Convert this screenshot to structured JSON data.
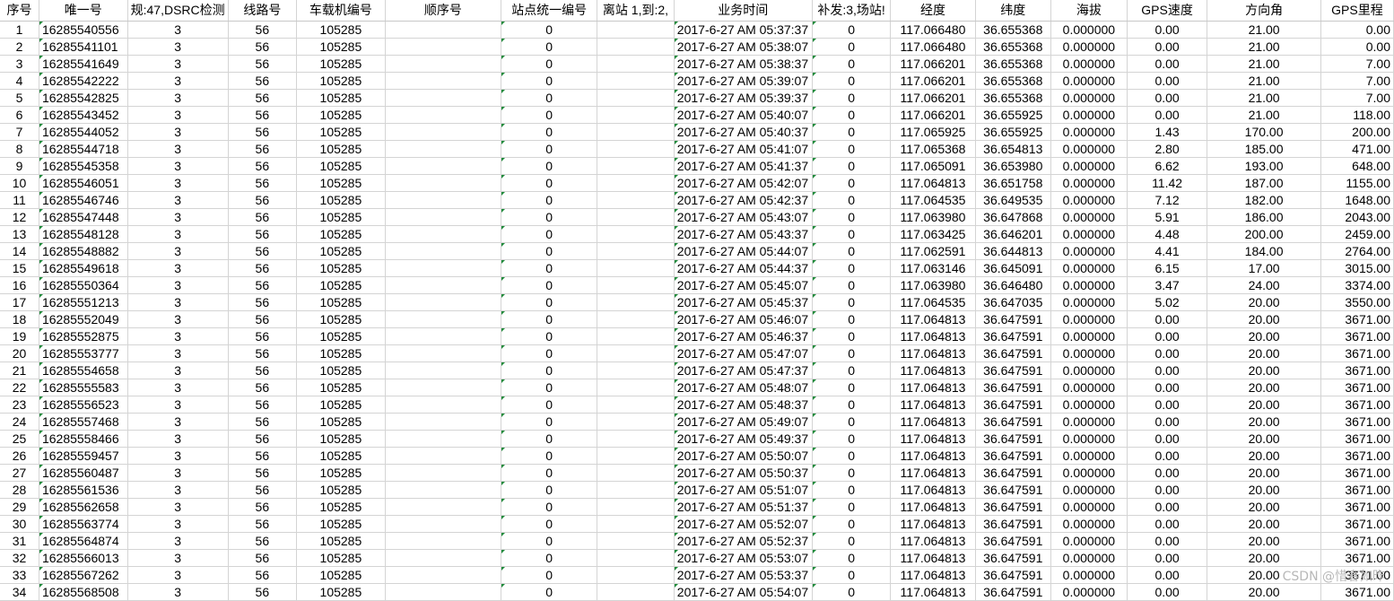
{
  "headers": [
    "序号",
    "唯一号",
    "规:47,DSRC检测",
    "线路号",
    "车载机编号",
    "顺序号",
    "站点统一编号",
    "离站 1,到:2,",
    "业务时间",
    "补发:3,场站!",
    "经度",
    "纬度",
    "海拔",
    "GPS速度",
    "方向角",
    "GPS里程"
  ],
  "rows": [
    [
      "1",
      "16285540556",
      "3",
      "56",
      "105285",
      "",
      "0",
      "",
      "2017-6-27 AM 05:37:37",
      "0",
      "117.066480",
      "36.655368",
      "0.000000",
      "0.00",
      "21.00",
      "0.00"
    ],
    [
      "2",
      "16285541101",
      "3",
      "56",
      "105285",
      "",
      "0",
      "",
      "2017-6-27 AM 05:38:07",
      "0",
      "117.066480",
      "36.655368",
      "0.000000",
      "0.00",
      "21.00",
      "0.00"
    ],
    [
      "3",
      "16285541649",
      "3",
      "56",
      "105285",
      "",
      "0",
      "",
      "2017-6-27 AM 05:38:37",
      "0",
      "117.066201",
      "36.655368",
      "0.000000",
      "0.00",
      "21.00",
      "7.00"
    ],
    [
      "4",
      "16285542222",
      "3",
      "56",
      "105285",
      "",
      "0",
      "",
      "2017-6-27 AM 05:39:07",
      "0",
      "117.066201",
      "36.655368",
      "0.000000",
      "0.00",
      "21.00",
      "7.00"
    ],
    [
      "5",
      "16285542825",
      "3",
      "56",
      "105285",
      "",
      "0",
      "",
      "2017-6-27 AM 05:39:37",
      "0",
      "117.066201",
      "36.655368",
      "0.000000",
      "0.00",
      "21.00",
      "7.00"
    ],
    [
      "6",
      "16285543452",
      "3",
      "56",
      "105285",
      "",
      "0",
      "",
      "2017-6-27 AM 05:40:07",
      "0",
      "117.066201",
      "36.655925",
      "0.000000",
      "0.00",
      "21.00",
      "118.00"
    ],
    [
      "7",
      "16285544052",
      "3",
      "56",
      "105285",
      "",
      "0",
      "",
      "2017-6-27 AM 05:40:37",
      "0",
      "117.065925",
      "36.655925",
      "0.000000",
      "1.43",
      "170.00",
      "200.00"
    ],
    [
      "8",
      "16285544718",
      "3",
      "56",
      "105285",
      "",
      "0",
      "",
      "2017-6-27 AM 05:41:07",
      "0",
      "117.065368",
      "36.654813",
      "0.000000",
      "2.80",
      "185.00",
      "471.00"
    ],
    [
      "9",
      "16285545358",
      "3",
      "56",
      "105285",
      "",
      "0",
      "",
      "2017-6-27 AM 05:41:37",
      "0",
      "117.065091",
      "36.653980",
      "0.000000",
      "6.62",
      "193.00",
      "648.00"
    ],
    [
      "10",
      "16285546051",
      "3",
      "56",
      "105285",
      "",
      "0",
      "",
      "2017-6-27 AM 05:42:07",
      "0",
      "117.064813",
      "36.651758",
      "0.000000",
      "11.42",
      "187.00",
      "1155.00"
    ],
    [
      "11",
      "16285546746",
      "3",
      "56",
      "105285",
      "",
      "0",
      "",
      "2017-6-27 AM 05:42:37",
      "0",
      "117.064535",
      "36.649535",
      "0.000000",
      "7.12",
      "182.00",
      "1648.00"
    ],
    [
      "12",
      "16285547448",
      "3",
      "56",
      "105285",
      "",
      "0",
      "",
      "2017-6-27 AM 05:43:07",
      "0",
      "117.063980",
      "36.647868",
      "0.000000",
      "5.91",
      "186.00",
      "2043.00"
    ],
    [
      "13",
      "16285548128",
      "3",
      "56",
      "105285",
      "",
      "0",
      "",
      "2017-6-27 AM 05:43:37",
      "0",
      "117.063425",
      "36.646201",
      "0.000000",
      "4.48",
      "200.00",
      "2459.00"
    ],
    [
      "14",
      "16285548882",
      "3",
      "56",
      "105285",
      "",
      "0",
      "",
      "2017-6-27 AM 05:44:07",
      "0",
      "117.062591",
      "36.644813",
      "0.000000",
      "4.41",
      "184.00",
      "2764.00"
    ],
    [
      "15",
      "16285549618",
      "3",
      "56",
      "105285",
      "",
      "0",
      "",
      "2017-6-27 AM 05:44:37",
      "0",
      "117.063146",
      "36.645091",
      "0.000000",
      "6.15",
      "17.00",
      "3015.00"
    ],
    [
      "16",
      "16285550364",
      "3",
      "56",
      "105285",
      "",
      "0",
      "",
      "2017-6-27 AM 05:45:07",
      "0",
      "117.063980",
      "36.646480",
      "0.000000",
      "3.47",
      "24.00",
      "3374.00"
    ],
    [
      "17",
      "16285551213",
      "3",
      "56",
      "105285",
      "",
      "0",
      "",
      "2017-6-27 AM 05:45:37",
      "0",
      "117.064535",
      "36.647035",
      "0.000000",
      "5.02",
      "20.00",
      "3550.00"
    ],
    [
      "18",
      "16285552049",
      "3",
      "56",
      "105285",
      "",
      "0",
      "",
      "2017-6-27 AM 05:46:07",
      "0",
      "117.064813",
      "36.647591",
      "0.000000",
      "0.00",
      "20.00",
      "3671.00"
    ],
    [
      "19",
      "16285552875",
      "3",
      "56",
      "105285",
      "",
      "0",
      "",
      "2017-6-27 AM 05:46:37",
      "0",
      "117.064813",
      "36.647591",
      "0.000000",
      "0.00",
      "20.00",
      "3671.00"
    ],
    [
      "20",
      "16285553777",
      "3",
      "56",
      "105285",
      "",
      "0",
      "",
      "2017-6-27 AM 05:47:07",
      "0",
      "117.064813",
      "36.647591",
      "0.000000",
      "0.00",
      "20.00",
      "3671.00"
    ],
    [
      "21",
      "16285554658",
      "3",
      "56",
      "105285",
      "",
      "0",
      "",
      "2017-6-27 AM 05:47:37",
      "0",
      "117.064813",
      "36.647591",
      "0.000000",
      "0.00",
      "20.00",
      "3671.00"
    ],
    [
      "22",
      "16285555583",
      "3",
      "56",
      "105285",
      "",
      "0",
      "",
      "2017-6-27 AM 05:48:07",
      "0",
      "117.064813",
      "36.647591",
      "0.000000",
      "0.00",
      "20.00",
      "3671.00"
    ],
    [
      "23",
      "16285556523",
      "3",
      "56",
      "105285",
      "",
      "0",
      "",
      "2017-6-27 AM 05:48:37",
      "0",
      "117.064813",
      "36.647591",
      "0.000000",
      "0.00",
      "20.00",
      "3671.00"
    ],
    [
      "24",
      "16285557468",
      "3",
      "56",
      "105285",
      "",
      "0",
      "",
      "2017-6-27 AM 05:49:07",
      "0",
      "117.064813",
      "36.647591",
      "0.000000",
      "0.00",
      "20.00",
      "3671.00"
    ],
    [
      "25",
      "16285558466",
      "3",
      "56",
      "105285",
      "",
      "0",
      "",
      "2017-6-27 AM 05:49:37",
      "0",
      "117.064813",
      "36.647591",
      "0.000000",
      "0.00",
      "20.00",
      "3671.00"
    ],
    [
      "26",
      "16285559457",
      "3",
      "56",
      "105285",
      "",
      "0",
      "",
      "2017-6-27 AM 05:50:07",
      "0",
      "117.064813",
      "36.647591",
      "0.000000",
      "0.00",
      "20.00",
      "3671.00"
    ],
    [
      "27",
      "16285560487",
      "3",
      "56",
      "105285",
      "",
      "0",
      "",
      "2017-6-27 AM 05:50:37",
      "0",
      "117.064813",
      "36.647591",
      "0.000000",
      "0.00",
      "20.00",
      "3671.00"
    ],
    [
      "28",
      "16285561536",
      "3",
      "56",
      "105285",
      "",
      "0",
      "",
      "2017-6-27 AM 05:51:07",
      "0",
      "117.064813",
      "36.647591",
      "0.000000",
      "0.00",
      "20.00",
      "3671.00"
    ],
    [
      "29",
      "16285562658",
      "3",
      "56",
      "105285",
      "",
      "0",
      "",
      "2017-6-27 AM 05:51:37",
      "0",
      "117.064813",
      "36.647591",
      "0.000000",
      "0.00",
      "20.00",
      "3671.00"
    ],
    [
      "30",
      "16285563774",
      "3",
      "56",
      "105285",
      "",
      "0",
      "",
      "2017-6-27 AM 05:52:07",
      "0",
      "117.064813",
      "36.647591",
      "0.000000",
      "0.00",
      "20.00",
      "3671.00"
    ],
    [
      "31",
      "16285564874",
      "3",
      "56",
      "105285",
      "",
      "0",
      "",
      "2017-6-27 AM 05:52:37",
      "0",
      "117.064813",
      "36.647591",
      "0.000000",
      "0.00",
      "20.00",
      "3671.00"
    ],
    [
      "32",
      "16285566013",
      "3",
      "56",
      "105285",
      "",
      "0",
      "",
      "2017-6-27 AM 05:53:07",
      "0",
      "117.064813",
      "36.647591",
      "0.000000",
      "0.00",
      "20.00",
      "3671.00"
    ],
    [
      "33",
      "16285567262",
      "3",
      "56",
      "105285",
      "",
      "0",
      "",
      "2017-6-27 AM 05:53:37",
      "0",
      "117.064813",
      "36.647591",
      "0.000000",
      "0.00",
      "20.00",
      "3671.00"
    ],
    [
      "34",
      "16285568508",
      "3",
      "56",
      "105285",
      "",
      "0",
      "",
      "2017-6-27 AM 05:54:07",
      "0",
      "117.064813",
      "36.647591",
      "0.000000",
      "0.00",
      "20.00",
      "3671.00"
    ]
  ],
  "watermark": "CSDN @惜春如昨",
  "colors": {
    "gridline": "#d4d4d4",
    "error_marker": "#1f8a3a"
  }
}
